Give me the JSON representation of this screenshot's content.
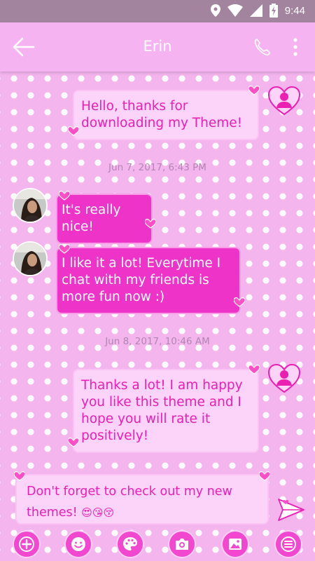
{
  "status": {
    "time": "9:44"
  },
  "header": {
    "title": "Erin"
  },
  "messages": [
    {
      "dir": "out",
      "text": "Hello, thanks for downloading my Theme!"
    },
    {
      "type": "timestamp",
      "text": "Jun 7, 2017, 6:43 PM"
    },
    {
      "dir": "in",
      "text": "It's really nice!"
    },
    {
      "dir": "in",
      "text": "I like it a lot! Everytime I chat with my friends is more fun now :)"
    },
    {
      "type": "timestamp",
      "text": "Jun 8, 2017, 10:46 AM"
    },
    {
      "dir": "out",
      "text": "Thanks a lot! I am happy you like this theme and I hope you will rate it positively!"
    }
  ],
  "compose": {
    "text": "Don't forget to check out my new themes!",
    "emoji": "😍😘😚"
  },
  "toolbar": {
    "items": [
      "add-icon",
      "emoji-icon",
      "palette-icon",
      "camera-icon",
      "image-icon",
      "menu-icon"
    ]
  },
  "colors": {
    "accent": "#ee33c8",
    "bubble_out": "#fcd3f9",
    "text_out": "#ec1fb3",
    "appbar": "#f6b3f1",
    "statusbar": "#a2849e"
  }
}
